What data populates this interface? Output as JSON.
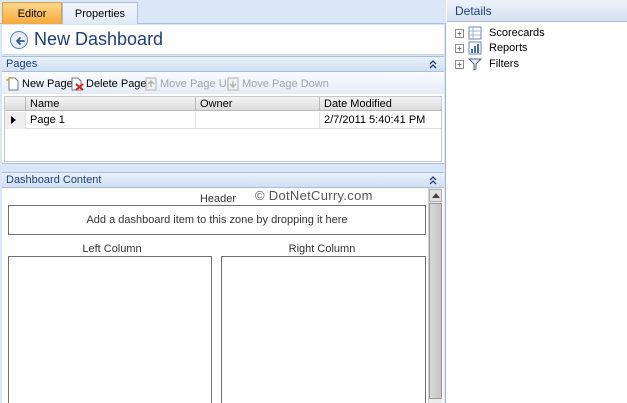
{
  "tabs": [
    {
      "label": "Editor",
      "active": true
    },
    {
      "label": "Properties",
      "active": false
    }
  ],
  "editor": {
    "title": "New Dashboard",
    "pages_section": {
      "title": "Pages",
      "toolbar": {
        "new_page": "New Page",
        "delete_page": "Delete Page",
        "move_up": "Move Page Up",
        "move_down": "Move Page Down"
      },
      "columns": [
        "Name",
        "Owner",
        "Date Modified"
      ],
      "rows": [
        {
          "name": "Page 1",
          "owner": "",
          "date_modified": "2/7/2011 5:40:41 PM"
        }
      ]
    },
    "content_section": {
      "title": "Dashboard Content",
      "header_zone_label": "Header",
      "header_zone_hint": "Add a dashboard item to this zone by dropping it here",
      "left_column_label": "Left Column",
      "right_column_label": "Right Column"
    },
    "watermark": "© DotNetCurry.com"
  },
  "details": {
    "title": "Details",
    "tree": [
      {
        "label": "Scorecards",
        "icon": "scorecard-icon"
      },
      {
        "label": "Reports",
        "icon": "report-icon"
      },
      {
        "label": "Filters",
        "icon": "filter-icon"
      }
    ]
  },
  "colors": {
    "active_tab": "#f7a93a",
    "title_text": "#1d3f7a",
    "pane_bg": "#d9e6f5"
  }
}
